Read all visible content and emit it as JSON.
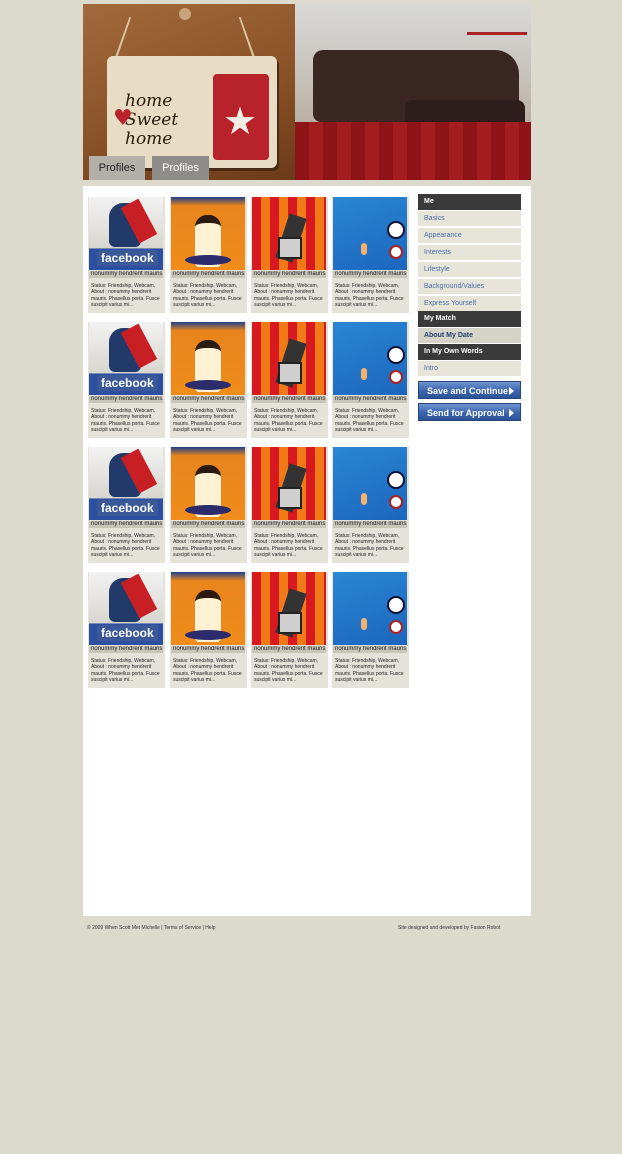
{
  "header": {
    "sign_text": "home Sweet home",
    "tabs": [
      "Profiles",
      "Profiles"
    ]
  },
  "profiles": {
    "cards": [
      {
        "thumb": "facebook-hero",
        "badge": "facebook",
        "name": "nonummy hendrerit mauris.",
        "desc": "Status: Friendship, Webcam, About : nonummy hendrerit mauris. Phasellus porta. Fusce suscipit varius mi..."
      },
      {
        "thumb": "wonder-woman",
        "name": "nonummy hendrerit mauris.",
        "desc": "Status: Friendship, Webcam, About : nonummy hendrerit mauris. Phasellus porta. Fusce suscipit varius mi..."
      },
      {
        "thumb": "iron-figure",
        "name": "nonummy hendrerit mauris.",
        "desc": "Status: Friendship, Webcam, About : nonummy hendrerit mauris. Phasellus porta. Fusce suscipit varius mi..."
      },
      {
        "thumb": "blue-space",
        "name": "nonummy hendrerit mauris.",
        "desc": "Status: Friendship, Webcam, About : nonummy hendrerit mauris. Phasellus porta. Fusce suscipit varius mi..."
      },
      {
        "thumb": "facebook-hero",
        "badge": "facebook",
        "name": "nonummy hendrerit mauris.",
        "desc": "Status: Friendship, Webcam, About : nonummy hendrerit mauris. Phasellus porta. Fusce suscipit varius mi..."
      },
      {
        "thumb": "wonder-woman",
        "name": "nonummy hendrerit mauris.",
        "desc": "Status: Friendship, Webcam, About : nonummy hendrerit mauris. Phasellus porta. Fusce suscipit varius mi..."
      },
      {
        "thumb": "iron-figure",
        "name": "nonummy hendrerit mauris.",
        "desc": "Status: Friendship, Webcam, About : nonummy hendrerit mauris. Phasellus porta. Fusce suscipit varius mi..."
      },
      {
        "thumb": "blue-space",
        "name": "nonummy hendrerit mauris.",
        "desc": "Status: Friendship, Webcam, About : nonummy hendrerit mauris. Phasellus porta. Fusce suscipit varius mi..."
      },
      {
        "thumb": "facebook-hero",
        "badge": "facebook",
        "name": "nonummy hendrerit mauris.",
        "desc": "Status: Friendship, Webcam, About : nonummy hendrerit mauris. Phasellus porta. Fusce suscipit varius mi..."
      },
      {
        "thumb": "wonder-woman",
        "name": "nonummy hendrerit mauris.",
        "desc": "Status: Friendship, Webcam, About : nonummy hendrerit mauris. Phasellus porta. Fusce suscipit varius mi..."
      },
      {
        "thumb": "iron-figure",
        "name": "nonummy hendrerit mauris.",
        "desc": "Status: Friendship, Webcam, About : nonummy hendrerit mauris. Phasellus porta. Fusce suscipit varius mi..."
      },
      {
        "thumb": "blue-space",
        "name": "nonummy hendrerit mauris.",
        "desc": "Status: Friendship, Webcam, About : nonummy hendrerit mauris. Phasellus porta. Fusce suscipit varius mi..."
      },
      {
        "thumb": "facebook-hero",
        "badge": "facebook",
        "name": "nonummy hendrerit mauris.",
        "desc": "Status: Friendship, Webcam, About : nonummy hendrerit mauris. Phasellus porta. Fusce suscipit varius mi..."
      },
      {
        "thumb": "wonder-woman",
        "name": "nonummy hendrerit mauris.",
        "desc": "Status: Friendship, Webcam, About : nonummy hendrerit mauris. Phasellus porta. Fusce suscipit varius mi..."
      },
      {
        "thumb": "iron-figure",
        "name": "nonummy hendrerit mauris.",
        "desc": "Status: Friendship, Webcam, About : nonummy hendrerit mauris. Phasellus porta. Fusce suscipit varius mi..."
      },
      {
        "thumb": "blue-space",
        "name": "nonummy hendrerit mauris.",
        "desc": "Status: Friendship, Webcam, About : nonummy hendrerit mauris. Phasellus porta. Fusce suscipit varius mi..."
      }
    ]
  },
  "nav": {
    "me": "Me",
    "me_items": [
      "Basics",
      "Appearance",
      "Interests",
      "Lifestyle",
      "Background/Values",
      "Express Yourself"
    ],
    "my_match": "My Match",
    "my_match_items": [
      "About My Date"
    ],
    "own_words": "In My Own Words",
    "own_words_items": [
      "Intro"
    ],
    "save_button": "Save and Continue",
    "approval_button": "Send for Approval"
  },
  "footer": {
    "copyright": "© 2009 When Scott Met Michelle",
    "links": [
      "Terms of Service",
      "Help"
    ],
    "credit": "Site designed and developed by Fusion Robot"
  },
  "colors": {
    "page_bg": "#dcd9cd",
    "nav_header": "#3a3a3a",
    "link_blue": "#4a6fa8",
    "button_blue": "#3a64ad"
  }
}
